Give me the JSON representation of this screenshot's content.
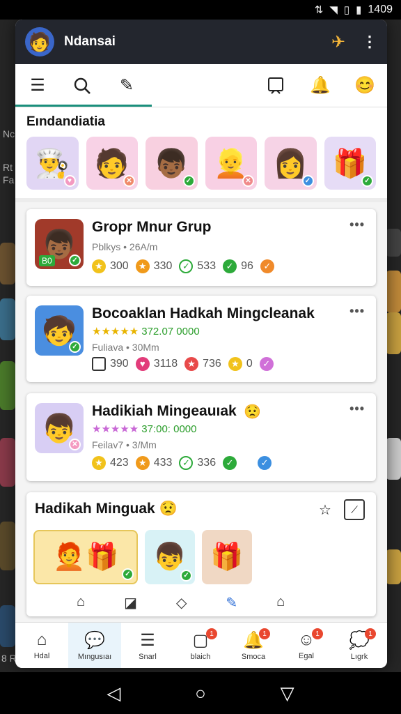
{
  "status": {
    "time": "1409"
  },
  "app": {
    "title": "Ndansai",
    "avatar_icon": "user-avatar-icon",
    "accent": "#1a8f7c"
  },
  "background": {
    "labels": [
      "Nc",
      "Rt",
      "Fa",
      "8 R"
    ]
  },
  "featured": {
    "heading": "Eındandiatia"
  },
  "cards": [
    {
      "title": "Gropr Mnur Grup",
      "subtitle": "Pblkys • 26A/m",
      "thumb_tag": "B0",
      "stats": [
        "300",
        "330",
        "533",
        "96"
      ]
    },
    {
      "title": "Bocoaklan Hadkah Mingcleanak",
      "rating": "372.07 0000",
      "subtitle": "Fuliava • 30Mm",
      "stats": [
        "390",
        "3118",
        "736",
        "0"
      ]
    },
    {
      "title": "Hadikiah Mingeauıak",
      "rating": "37:00: 0000",
      "subtitle": "Feilav7 • 3/Mm",
      "stats": [
        "423",
        "433",
        "336"
      ]
    }
  ],
  "bundle": {
    "title": "Hadikah Minguak"
  },
  "bottom_nav": [
    {
      "label": "Hdal"
    },
    {
      "label": "Mıngusıaı"
    },
    {
      "label": "Snarl"
    },
    {
      "label": "blaich",
      "badge": "1"
    },
    {
      "label": "Smoca",
      "badge": "1"
    },
    {
      "label": "Egal",
      "badge": "1"
    },
    {
      "label": "Lıgrk",
      "badge": "1"
    }
  ]
}
